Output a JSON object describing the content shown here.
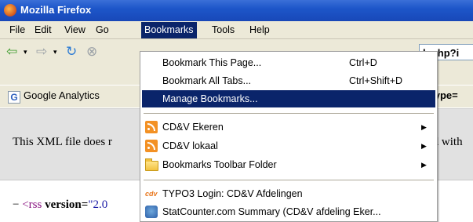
{
  "window": {
    "title": "Mozilla Firefox"
  },
  "menubar": {
    "items": [
      {
        "label": "File"
      },
      {
        "label": "Edit"
      },
      {
        "label": "View"
      },
      {
        "label": "Go"
      },
      {
        "label": "Bookmarks"
      },
      {
        "label": "Tools"
      },
      {
        "label": "Help"
      }
    ]
  },
  "address": {
    "visible_text": "k.php?i"
  },
  "bookmarks_toolbar": {
    "item": "Google Analytics",
    "type_fragment": "&type="
  },
  "content": {
    "notice_left": "This XML file does r",
    "notice_right": "ed with",
    "rss_dash": "−",
    "rss_tag": "<rss",
    "rss_attr": "version=",
    "rss_val": "\"2.0"
  },
  "bookmarks_menu": {
    "items": [
      {
        "label": "Bookmark This Page...",
        "shortcut": "Ctrl+D"
      },
      {
        "label": "Bookmark All Tabs...",
        "shortcut": "Ctrl+Shift+D"
      },
      {
        "label": "Manage Bookmarks..."
      },
      {
        "label": "CD&V Ekeren",
        "icon": "rss-feed-icon",
        "submenu": true
      },
      {
        "label": "CD&V lokaal",
        "icon": "rss-feed-icon",
        "submenu": true
      },
      {
        "label": "Bookmarks Toolbar Folder",
        "icon": "folder-icon",
        "submenu": true
      },
      {
        "label": "TYPO3 Login: CD&V Afdelingen",
        "icon": "typo3-icon"
      },
      {
        "label": "StatCounter.com Summary (CD&V afdeling Eker...",
        "icon": "statcounter-icon"
      }
    ],
    "highlighted_index": 2
  },
  "colors": {
    "titlebar": "#1d56c9",
    "menu_highlight": "#0a246a",
    "chrome": "#ece9d8",
    "notice_bg": "#e1e1e1"
  },
  "icons": {
    "back": "back-arrow-icon",
    "forward": "forward-arrow-icon",
    "reload": "reload-icon",
    "stop": "stop-icon"
  }
}
